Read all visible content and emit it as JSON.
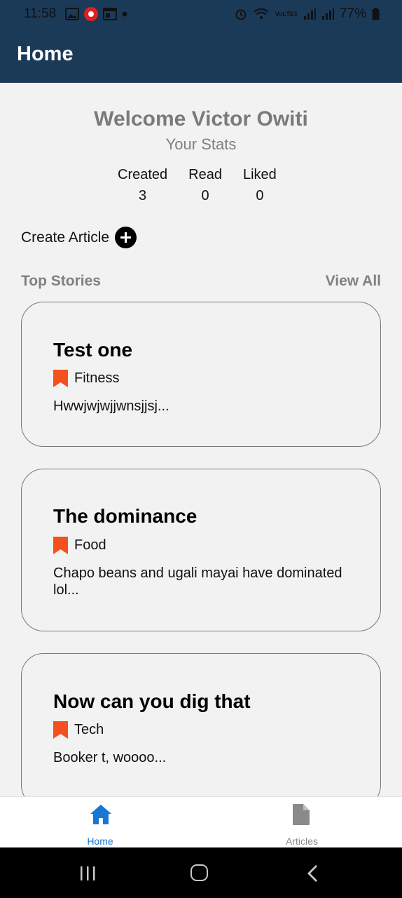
{
  "status_bar": {
    "time": "11:58",
    "battery": "77%",
    "network_label": "VoLTE1",
    "icons": [
      "image-icon",
      "notification-app-icon",
      "calendar-icon",
      "dot-icon",
      "alarm-icon",
      "wifi-icon",
      "signal-icon",
      "signal-icon-2",
      "battery-icon"
    ]
  },
  "header": {
    "title": "Home"
  },
  "welcome": {
    "greeting": "Welcome Victor Owiti",
    "stats_title": "Your Stats",
    "stats": [
      {
        "label": "Created",
        "value": "3"
      },
      {
        "label": "Read",
        "value": "0"
      },
      {
        "label": "Liked",
        "value": "0"
      }
    ]
  },
  "create_article": {
    "label": "Create Article",
    "icon": "plus-circle-icon"
  },
  "top_stories": {
    "title": "Top Stories",
    "view_all": "View All",
    "articles": [
      {
        "title": "Test one",
        "category": "Fitness",
        "excerpt": "Hwwjwjwjjwnsjjsj..."
      },
      {
        "title": "The dominance",
        "category": "Food",
        "excerpt": "Chapo beans and ugali mayai have dominated lol..."
      },
      {
        "title": "Now can you dig that",
        "category": "Tech",
        "excerpt": "Booker t, woooo..."
      }
    ]
  },
  "bottom_nav": {
    "items": [
      {
        "label": "Home",
        "icon": "home-icon",
        "active": true
      },
      {
        "label": "Articles",
        "icon": "document-icon",
        "active": false
      }
    ]
  },
  "colors": {
    "header_bg": "#1b3a58",
    "accent": "#1976d2",
    "bookmark": "#f4511e",
    "background": "#f2f2f2"
  }
}
